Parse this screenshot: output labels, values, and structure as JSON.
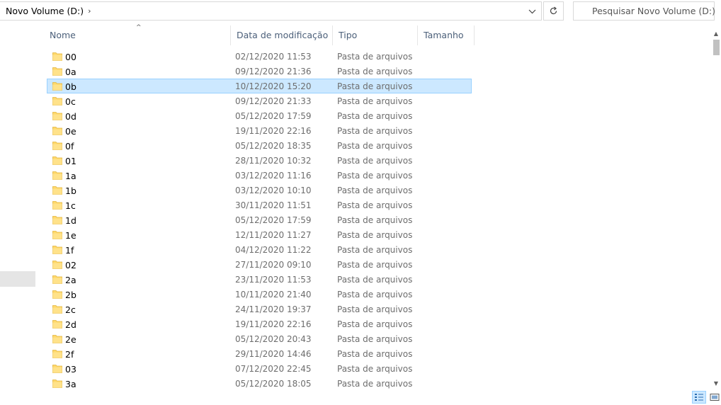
{
  "address": {
    "location": "Novo Volume  (D:)",
    "separator": "›"
  },
  "search": {
    "placeholder": "Pesquisar Novo Volume  (D:)"
  },
  "columns": {
    "name": "Nome",
    "date": "Data de modificação",
    "type": "Tipo",
    "size": "Tamanho"
  },
  "files": [
    {
      "name": "00",
      "date": "02/12/2020 11:53",
      "type": "Pasta de arquivos"
    },
    {
      "name": "0a",
      "date": "09/12/2020 21:36",
      "type": "Pasta de arquivos"
    },
    {
      "name": "0b",
      "date": "10/12/2020 15:20",
      "type": "Pasta de arquivos",
      "selected": true
    },
    {
      "name": "0c",
      "date": "09/12/2020 21:33",
      "type": "Pasta de arquivos"
    },
    {
      "name": "0d",
      "date": "05/12/2020 17:59",
      "type": "Pasta de arquivos"
    },
    {
      "name": "0e",
      "date": "19/11/2020 22:16",
      "type": "Pasta de arquivos"
    },
    {
      "name": "0f",
      "date": "05/12/2020 18:35",
      "type": "Pasta de arquivos"
    },
    {
      "name": "01",
      "date": "28/11/2020 10:32",
      "type": "Pasta de arquivos"
    },
    {
      "name": "1a",
      "date": "03/12/2020 11:16",
      "type": "Pasta de arquivos"
    },
    {
      "name": "1b",
      "date": "03/12/2020 10:10",
      "type": "Pasta de arquivos"
    },
    {
      "name": "1c",
      "date": "30/11/2020 11:51",
      "type": "Pasta de arquivos"
    },
    {
      "name": "1d",
      "date": "05/12/2020 17:59",
      "type": "Pasta de arquivos"
    },
    {
      "name": "1e",
      "date": "12/11/2020 11:27",
      "type": "Pasta de arquivos"
    },
    {
      "name": "1f",
      "date": "04/12/2020 11:22",
      "type": "Pasta de arquivos"
    },
    {
      "name": "02",
      "date": "27/11/2020 09:10",
      "type": "Pasta de arquivos"
    },
    {
      "name": "2a",
      "date": "23/11/2020 11:53",
      "type": "Pasta de arquivos"
    },
    {
      "name": "2b",
      "date": "10/11/2020 21:40",
      "type": "Pasta de arquivos"
    },
    {
      "name": "2c",
      "date": "24/11/2020 19:37",
      "type": "Pasta de arquivos"
    },
    {
      "name": "2d",
      "date": "19/11/2020 22:16",
      "type": "Pasta de arquivos"
    },
    {
      "name": "2e",
      "date": "05/12/2020 20:43",
      "type": "Pasta de arquivos"
    },
    {
      "name": "2f",
      "date": "29/11/2020 14:46",
      "type": "Pasta de arquivos"
    },
    {
      "name": "03",
      "date": "07/12/2020 22:45",
      "type": "Pasta de arquivos"
    },
    {
      "name": "3a",
      "date": "05/12/2020 18:05",
      "type": "Pasta de arquivos"
    }
  ],
  "icons": {
    "folder": "folder-icon",
    "search": "search-icon",
    "refresh": "refresh-icon",
    "dropdown": "chevron-down-icon"
  },
  "colors": {
    "selection_bg": "#cce8ff",
    "selection_border": "#99d1ff",
    "header_text": "#4c607a",
    "folder": "#ffd86b"
  }
}
